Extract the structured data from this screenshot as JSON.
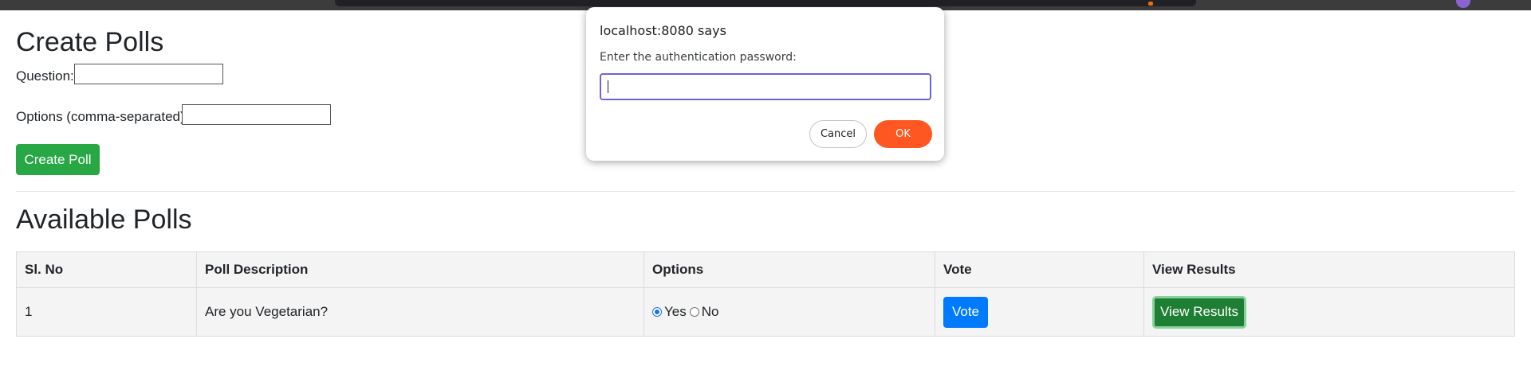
{
  "create_section": {
    "title": "Create Polls",
    "question_label": "Question:",
    "question_value": "",
    "options_label": "Options (comma-separated):",
    "options_value": "",
    "create_button": "Create Poll"
  },
  "available_section": {
    "title": "Available Polls",
    "columns": [
      "Sl. No",
      "Poll Description",
      "Options",
      "Vote",
      "View Results"
    ],
    "rows": [
      {
        "sl_no": "1",
        "description": "Are you Vegetarian?",
        "options": [
          {
            "label": "Yes",
            "selected": true
          },
          {
            "label": "No",
            "selected": false
          }
        ],
        "vote_button": "Vote",
        "results_button": "View Results"
      }
    ]
  },
  "dialog": {
    "title": "localhost:8080 says",
    "message": "Enter the authentication password:",
    "input_value": "",
    "cancel_button": "Cancel",
    "ok_button": "OK"
  },
  "colors": {
    "create_button": "#28a745",
    "vote_button": "#007bff",
    "results_button": "#1e7e34",
    "dialog_ok": "#ff5722",
    "dialog_input_focus": "#6c63d4"
  }
}
